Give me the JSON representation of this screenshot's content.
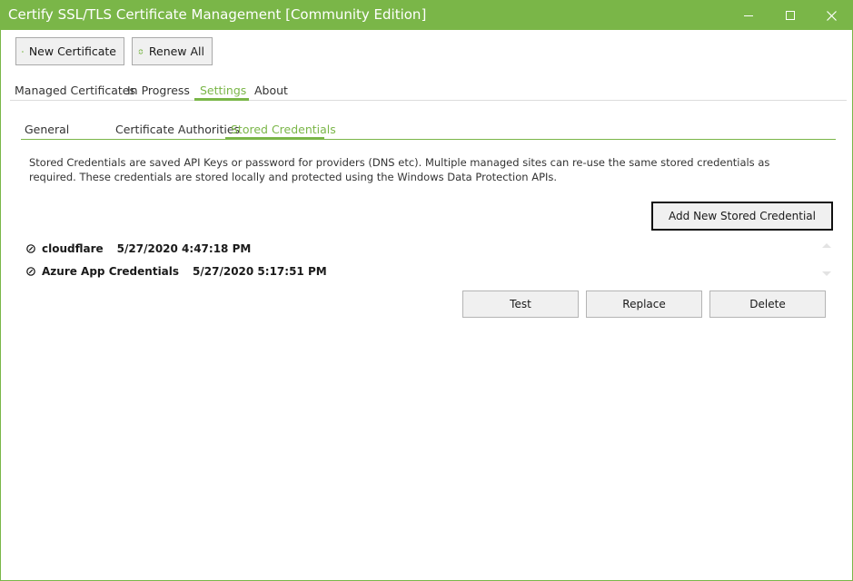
{
  "window": {
    "title": "Certify SSL/TLS Certificate Management [Community Edition]",
    "accent_color": "#7ab648"
  },
  "toolbar": {
    "new_certificate_label": "New Certificate",
    "new_certificate_icon": "plus-circle-icon",
    "renew_all_label": "Renew All",
    "renew_all_icon": "refresh-icon"
  },
  "main_tabs": [
    {
      "label": "Managed Certificates",
      "active": false
    },
    {
      "label": "In Progress",
      "active": false
    },
    {
      "label": "Settings",
      "active": true
    },
    {
      "label": "About",
      "active": false
    }
  ],
  "settings_tabs": [
    {
      "label": "General",
      "active": false
    },
    {
      "label": "Certificate Authorities",
      "active": false
    },
    {
      "label": "Stored Credentials",
      "active": true
    }
  ],
  "stored_credentials": {
    "description": "Stored Credentials are saved API Keys or password for providers (DNS etc). Multiple managed sites can re-use the same stored credentials as required. These credentials are stored locally and protected using the Windows Data Protection APIs.",
    "add_button_label": "Add New Stored Credential",
    "items": [
      {
        "name": "cloudflare",
        "date": "5/27/2020 4:47:18 PM"
      },
      {
        "name": "Azure App Credentials",
        "date": "5/27/2020 5:17:51 PM"
      }
    ],
    "actions": {
      "test_label": "Test",
      "replace_label": "Replace",
      "delete_label": "Delete"
    }
  }
}
